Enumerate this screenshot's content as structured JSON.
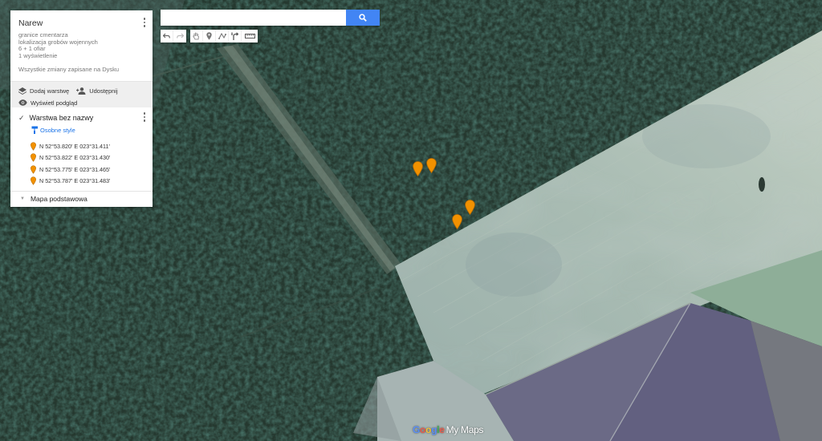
{
  "map": {
    "title": "Narew",
    "description": [
      "granice cmentarza",
      "lokalizacja grobów wojennych",
      "6 + 1 ofiar",
      "1 wyświetlenie"
    ],
    "saved_status": "Wszystkie zmiany zapisane na Dysku"
  },
  "actions": {
    "add_layer": "Dodaj warstwę",
    "share": "Udostępnij",
    "preview": "Wyświetl podgląd"
  },
  "layer": {
    "name": "Warstwa bez nazwy",
    "style_link": "Osobne style",
    "items": [
      "N 52°53.820' E 023°31.411'",
      "N 52°53.822' E 023°31.430'",
      "N 52°53.775' E 023°31.465'",
      "N 52°53.787' E 023°31.483'"
    ]
  },
  "base_map": {
    "label": "Mapa podstawowa"
  },
  "search": {
    "value": ""
  },
  "toolbar": [
    "undo",
    "redo",
    "hand-pan",
    "add-marker",
    "draw-line",
    "add-directions",
    "measure"
  ],
  "logo": {
    "google": "Google",
    "suffix": "My Maps"
  },
  "colors": {
    "marker": "#f29100",
    "accent": "#4285f4",
    "link": "#1a73e8"
  }
}
